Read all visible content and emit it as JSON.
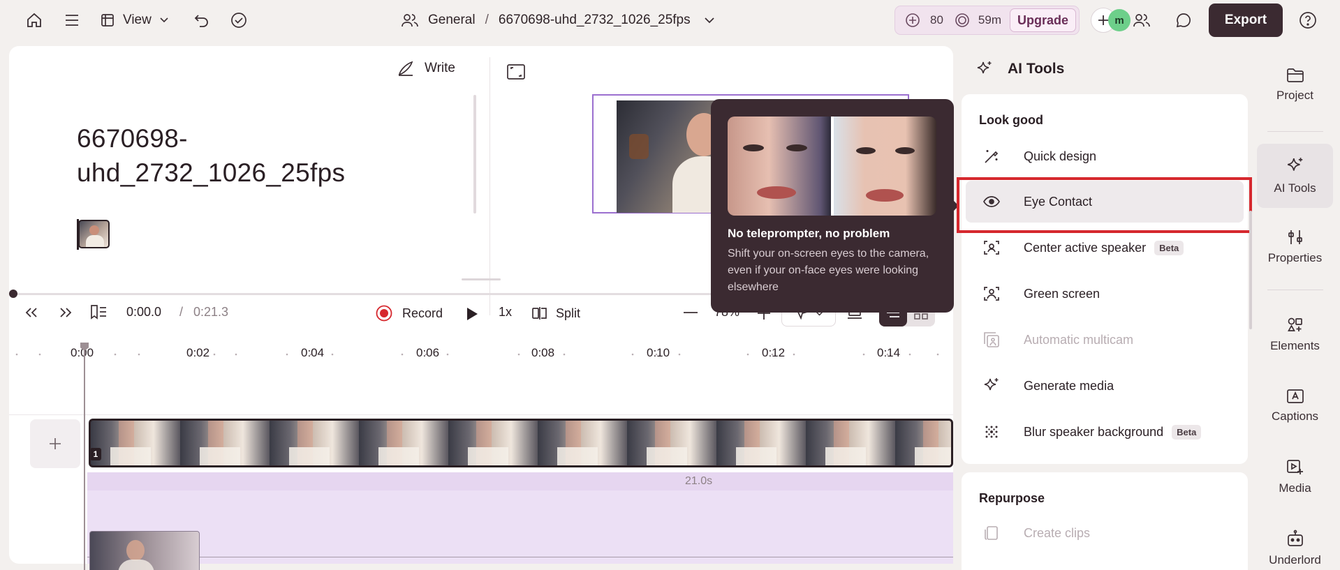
{
  "topbar": {
    "view_label": "View",
    "breadcrumb_workspace": "General",
    "breadcrumb_separator": "/",
    "project_name": "6670698-uhd_2732_1026_25fps",
    "credits": "80",
    "minutes": "59m",
    "upgrade_label": "Upgrade",
    "avatar_initial": "m",
    "export_label": "Export"
  },
  "script": {
    "write_label": "Write",
    "title_line1": "6670698-",
    "title_line2": "uhd_2732_1026_25fps"
  },
  "tooltip": {
    "title": "No teleprompter, no problem",
    "description": "Shift your on-screen eyes to the camera, even if your on-face eyes were looking elsewhere"
  },
  "playbar": {
    "current_time": "0:00.0",
    "time_separator": "/",
    "total_time": "0:21.3",
    "record_label": "Record",
    "speed_label": "1x",
    "split_label": "Split",
    "zoom_label": "78%"
  },
  "ruler": {
    "ticks": [
      "0:00",
      "0:02",
      "0:04",
      "0:06",
      "0:08",
      "0:10",
      "0:12",
      "0:14"
    ]
  },
  "tracks": {
    "track_number": "1",
    "duration_label": "21.0s"
  },
  "ai_panel": {
    "title": "AI Tools",
    "section_look_good": "Look good",
    "items": [
      {
        "label": "Quick design",
        "icon": "wand-icon",
        "disabled": false
      },
      {
        "label": "Eye Contact",
        "icon": "eye-icon",
        "disabled": false
      },
      {
        "label": "Center active speaker",
        "icon": "center-speaker-icon",
        "badge": "Beta",
        "disabled": false
      },
      {
        "label": "Green screen",
        "icon": "green-screen-icon",
        "disabled": false
      },
      {
        "label": "Automatic multicam",
        "icon": "multicam-icon",
        "disabled": true
      },
      {
        "label": "Generate media",
        "icon": "sparkle-icon",
        "disabled": false
      },
      {
        "label": "Blur speaker background",
        "icon": "blur-icon",
        "badge": "Beta",
        "disabled": false
      }
    ],
    "section_repurpose": "Repurpose",
    "repurpose_items": [
      {
        "label": "Create clips",
        "icon": "clips-icon",
        "disabled": true
      }
    ]
  },
  "rail": {
    "items": [
      {
        "label": "Project",
        "icon": "folder-icon"
      },
      {
        "label": "AI Tools",
        "icon": "sparkle-icon"
      },
      {
        "label": "Properties",
        "icon": "sliders-icon"
      },
      {
        "label": "Elements",
        "icon": "elements-icon"
      },
      {
        "label": "Captions",
        "icon": "captions-icon"
      },
      {
        "label": "Media",
        "icon": "media-icon"
      },
      {
        "label": "Underlord",
        "icon": "robot-icon"
      }
    ]
  },
  "colors": {
    "accent_purple": "#9b6fcf",
    "track_lavender": "#ece0f5",
    "highlight_red": "#d6282e",
    "export_bg": "#3b2a31",
    "tooltip_bg": "#3b2a31"
  }
}
